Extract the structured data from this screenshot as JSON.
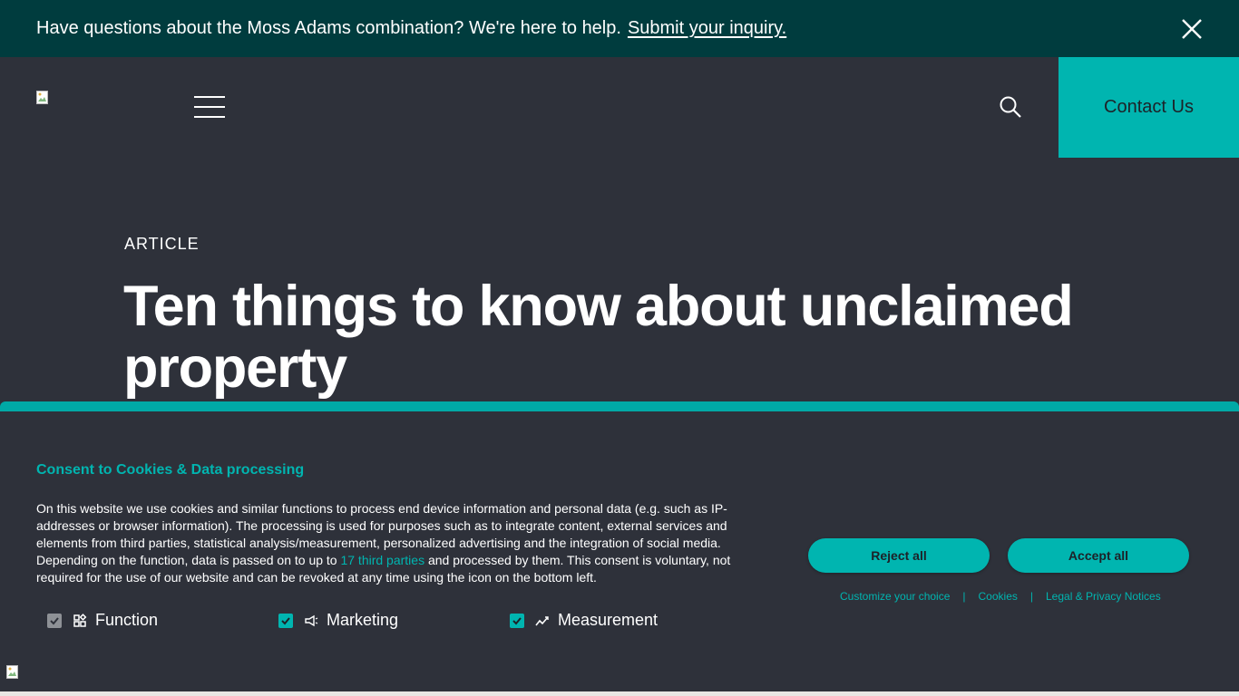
{
  "banner": {
    "text": "Have questions about the Moss Adams combination? We're here to help.",
    "link_label": "Submit your inquiry.",
    "close_icon": "close-icon",
    "background": "#003c3e"
  },
  "header": {
    "logo_icon": "broken-image-icon",
    "menu_icon": "hamburger-menu-icon",
    "search_icon": "search-icon",
    "contact_label": "Contact Us",
    "accent": "#00b5b0"
  },
  "hero": {
    "eyebrow": "ARTICLE",
    "title": "Ten things to know about unclaimed property"
  },
  "consent": {
    "title": "Consent to Cookies & Data processing",
    "text_before": "On this website we use cookies and similar functions to process end device information and personal data (e.g. such as IP-addresses or browser information). The processing is used for purposes such as to integrate content, external services and elements from third parties, statistical analysis/measurement, personalized advertising and the integration of social media. Depending on the function, data is passed on to up to ",
    "third_parties_link": "17 third parties",
    "text_after": " and processed by them. This consent is voluntary, not required for the use of our website and can be revoked at any time using the icon on the bottom left.",
    "options": [
      {
        "label": "Function",
        "checked": true,
        "disabled": true,
        "icon": "function-icon"
      },
      {
        "label": "Marketing",
        "checked": true,
        "disabled": false,
        "icon": "megaphone-icon"
      },
      {
        "label": "Measurement",
        "checked": true,
        "disabled": false,
        "icon": "chart-trend-icon"
      }
    ],
    "reject_label": "Reject all",
    "accept_label": "Accept all",
    "links": {
      "customize": "Customize your choice",
      "separator": "|",
      "cookies": "Cookies",
      "legal": "Legal & Privacy Notices"
    },
    "revoke_icon": "broken-image-icon"
  }
}
